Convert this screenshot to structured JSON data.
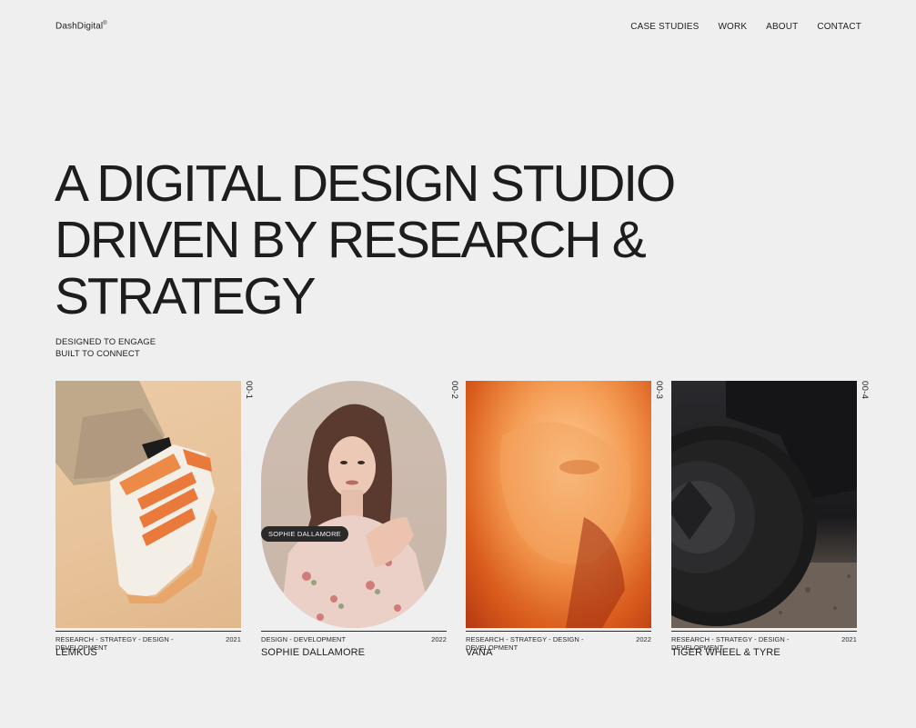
{
  "header": {
    "brand": "DashDigital",
    "brand_mark": "®",
    "nav": [
      {
        "label": "CASE STUDIES"
      },
      {
        "label": "WORK"
      },
      {
        "label": "ABOUT"
      },
      {
        "label": "CONTACT"
      }
    ]
  },
  "hero": {
    "lines": [
      "A DIGITAL DESIGN STUDIO",
      "DRIVEN BY RESEARCH &",
      "STRATEGY"
    ],
    "tagline": [
      "DESIGNED TO ENGAGE",
      "BUILT TO CONNECT"
    ]
  },
  "projects": [
    {
      "number": "00-1",
      "tags": "RESEARCH - STRATEGY - DESIGN - DEVELOPMENT",
      "year": "2021",
      "title": "LEMKUS",
      "image": "sneaker-photo"
    },
    {
      "number": "00-2",
      "tags": "DESIGN - DEVELOPMENT",
      "year": "2022",
      "title": "SOPHIE DALLAMORE",
      "image": "portrait-photo",
      "hover_label": "SOPHIE DALLAMORE"
    },
    {
      "number": "00-3",
      "tags": "RESEARCH - STRATEGY - DESIGN - DEVELOPMENT",
      "year": "2022",
      "title": "VANA",
      "image": "orange-face-photo"
    },
    {
      "number": "00-4",
      "tags": "RESEARCH - STRATEGY - DESIGN - DEVELOPMENT",
      "year": "2021",
      "title": "TIGER WHEEL & TYRE",
      "image": "offroad-tyre-photo"
    }
  ],
  "colors": {
    "background": "#efefef",
    "text": "#1d1d1d",
    "pill_bg": "#2a2a2a"
  }
}
